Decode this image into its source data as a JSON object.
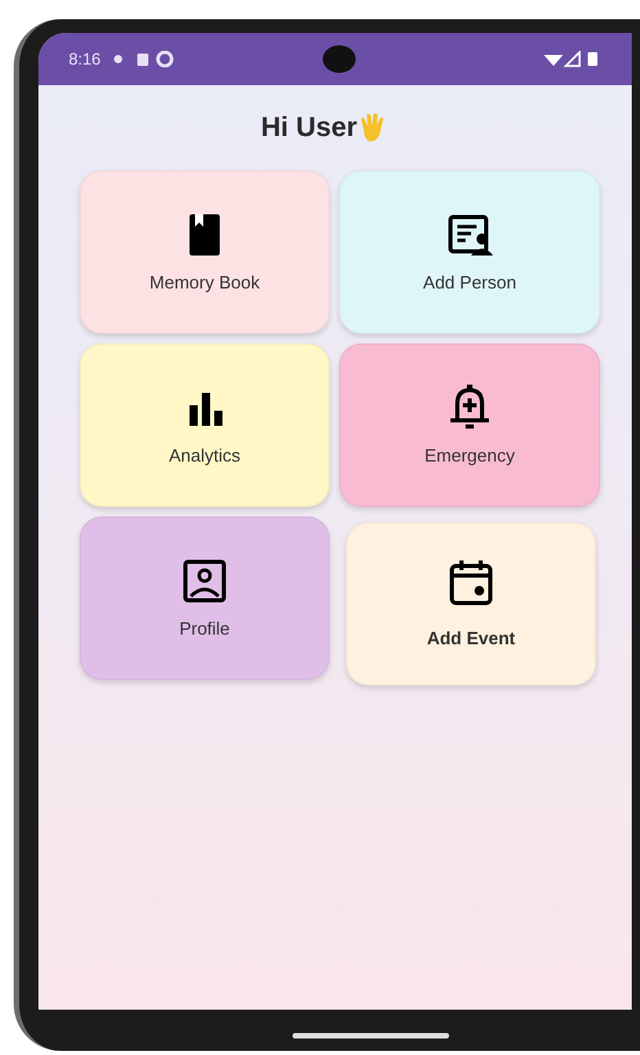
{
  "status_bar": {
    "time": "8:16"
  },
  "greeting": {
    "title": "Hi User"
  },
  "tiles": [
    {
      "label": "Memory Book",
      "color": "#fde2e4",
      "bold": false
    },
    {
      "label": "Add Person",
      "color": "#dff6f9",
      "bold": false
    },
    {
      "label": "Analytics",
      "color": "#fff8c6",
      "bold": false
    },
    {
      "label": "Emergency",
      "color": "#f8bbd2",
      "bold": false
    },
    {
      "label": "Profile",
      "color": "#dfbfe8",
      "bold": false
    },
    {
      "label": "Add Event",
      "color": "#fff1df",
      "bold": true
    }
  ]
}
